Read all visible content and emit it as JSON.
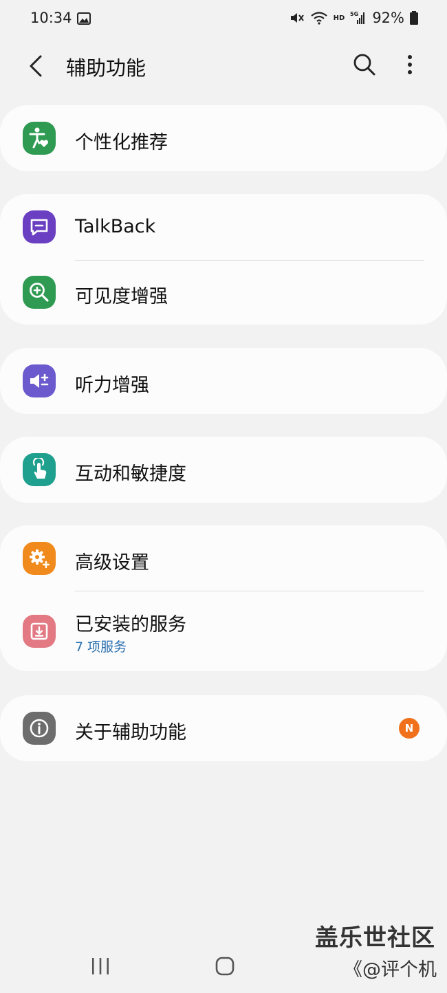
{
  "status_bar": {
    "time": "10:34",
    "battery": "92%",
    "network_hd": "HD",
    "network_5g": "5G"
  },
  "header": {
    "title": "辅助功能",
    "back_icon": "chevron-left-icon",
    "search_icon": "search-icon",
    "more_icon": "more-vertical-icon"
  },
  "sections": [
    {
      "items": [
        {
          "label": "个性化推荐",
          "icon": "accessibility-heart-icon",
          "color": "#2e9a52"
        }
      ]
    },
    {
      "items": [
        {
          "label": "TalkBack",
          "icon": "chat-bubble-icon",
          "color": "#6b3fc2"
        },
        {
          "label": "可见度增强",
          "icon": "zoom-in-icon",
          "color": "#2e9a52"
        }
      ]
    },
    {
      "items": [
        {
          "label": "听力增强",
          "icon": "speaker-plus-icon",
          "color": "#6a5acd"
        }
      ]
    },
    {
      "items": [
        {
          "label": "互动和敏捷度",
          "icon": "touch-hand-icon",
          "color": "#1fa08e"
        }
      ]
    },
    {
      "items": [
        {
          "label": "高级设置",
          "icon": "gear-plus-icon",
          "color": "#f08a1c"
        },
        {
          "label": "已安装的服务",
          "sublabel": "7 项服务",
          "icon": "download-icon",
          "color": "#e27983"
        }
      ]
    },
    {
      "items": [
        {
          "label": "关于辅助功能",
          "icon": "info-icon",
          "color": "#6d6d6d",
          "badge": "N"
        }
      ]
    }
  ],
  "watermark": {
    "line1": "盖乐世社区",
    "line2": "《@评个机"
  },
  "colors": {
    "background": "#f2f2f2",
    "card": "#fcfcfc",
    "sublabel": "#2a6fb0",
    "badge": "#f0701b"
  }
}
